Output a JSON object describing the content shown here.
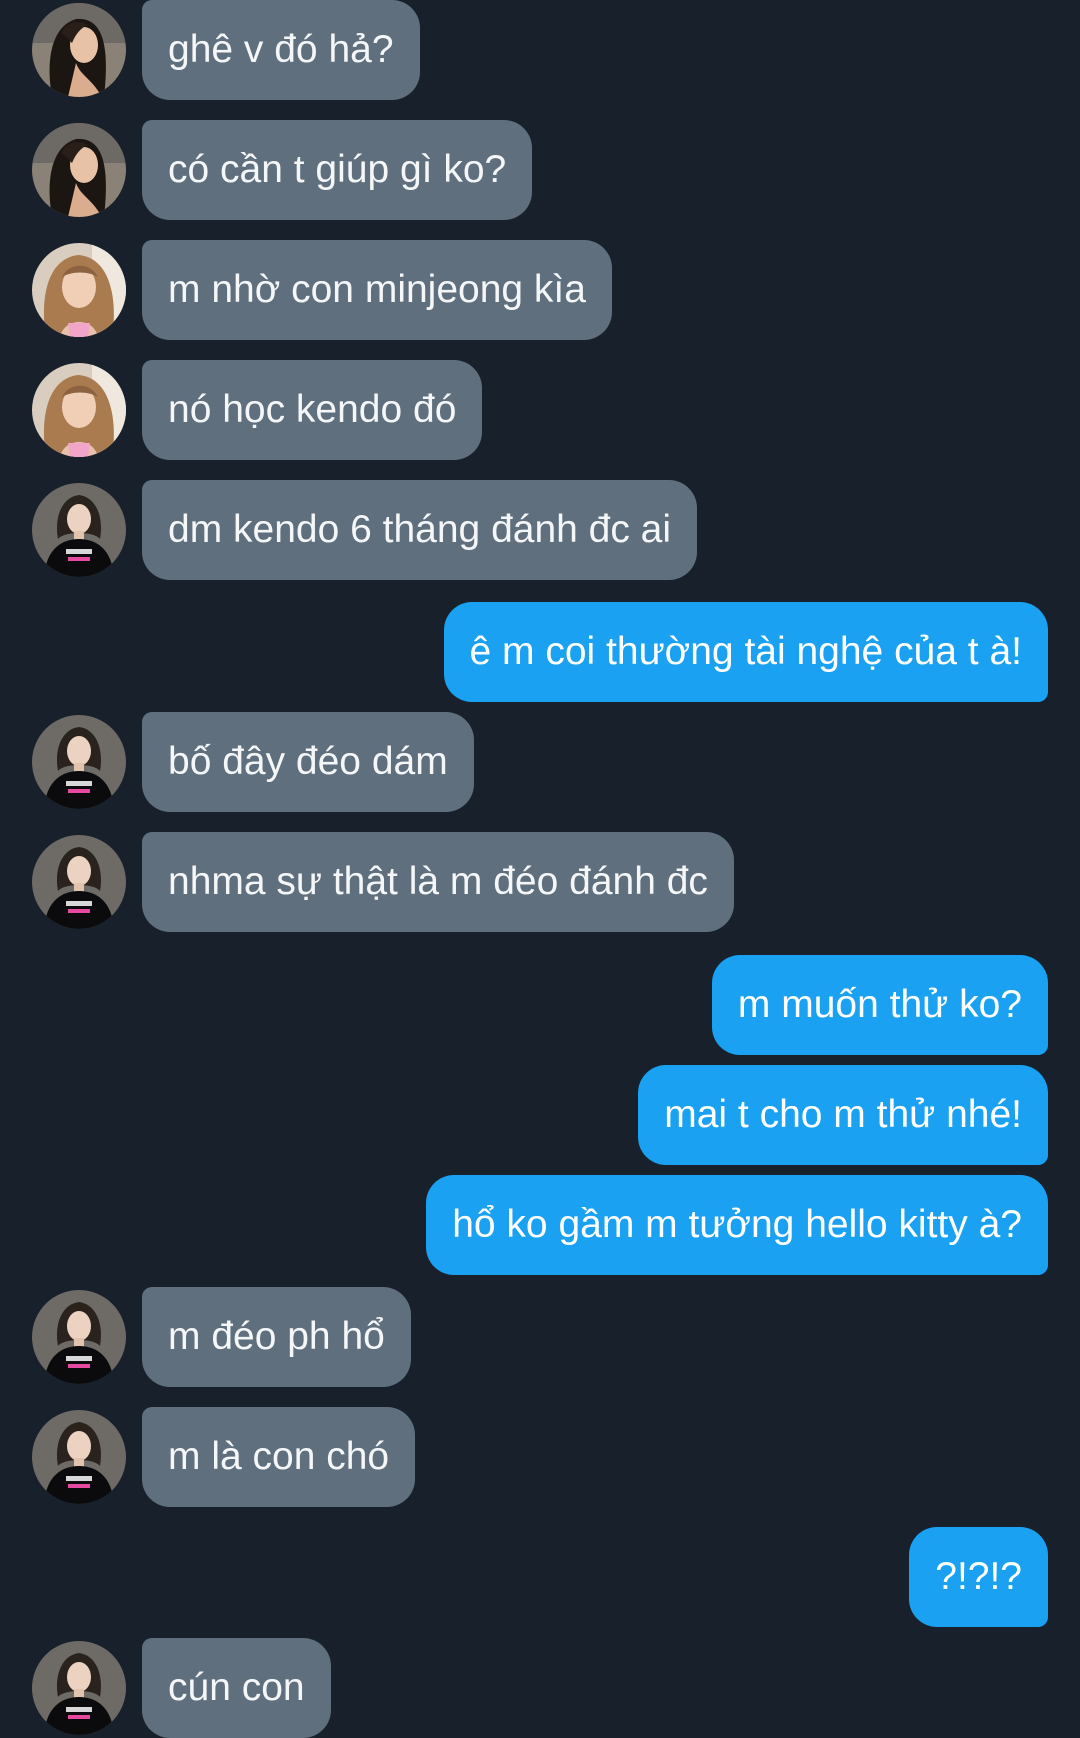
{
  "colors": {
    "background": "#17202b",
    "incoming_bubble": "#5f6f7d",
    "outgoing_bubble": "#1aa1f1",
    "text": "#ffffff"
  },
  "messages": [
    {
      "direction": "incoming",
      "avatar": "avatar-a",
      "text": "ghê v đó hả?"
    },
    {
      "direction": "incoming",
      "avatar": "avatar-a",
      "text": "có cần t giúp gì ko?"
    },
    {
      "direction": "incoming",
      "avatar": "avatar-b",
      "text": "m nhờ con minjeong kìa"
    },
    {
      "direction": "incoming",
      "avatar": "avatar-b",
      "text": "nó học kendo đó"
    },
    {
      "direction": "incoming",
      "avatar": "avatar-c",
      "text": "dm kendo 6 tháng đánh đc ai"
    },
    {
      "direction": "outgoing",
      "text": "ê m coi thường tài nghệ của t à!"
    },
    {
      "direction": "incoming",
      "avatar": "avatar-c",
      "text": "bố đây đéo dám"
    },
    {
      "direction": "incoming",
      "avatar": "avatar-c",
      "text": "nhma sự thật là m đéo đánh đc"
    },
    {
      "direction": "outgoing",
      "text": "m muốn thử ko?"
    },
    {
      "direction": "outgoing",
      "text": "mai t cho m thử nhé!"
    },
    {
      "direction": "outgoing",
      "text": "hổ ko gầm m tưởng hello kitty à?"
    },
    {
      "direction": "incoming",
      "avatar": "avatar-c",
      "text": "m đéo ph hổ"
    },
    {
      "direction": "incoming",
      "avatar": "avatar-c",
      "text": "m là con chó"
    },
    {
      "direction": "outgoing",
      "text": "?!?!?"
    },
    {
      "direction": "incoming",
      "avatar": "avatar-c",
      "text": "cún con"
    }
  ]
}
